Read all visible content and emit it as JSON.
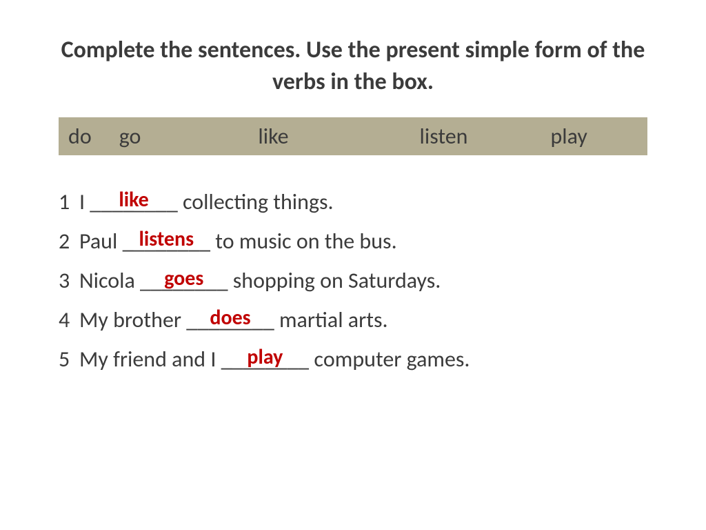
{
  "title": "Complete the sentences. Use the present simple form of  the verbs in the box.",
  "wordbox": {
    "w1": "do",
    "w2": "go",
    "w3": "like",
    "w4": "listen",
    "w5": "play"
  },
  "sentences": {
    "s1": {
      "num": "1",
      "before": "I ",
      "blank": "________",
      "answer": "like",
      "after": " collecting things."
    },
    "s2": {
      "num": "2",
      "before": "Paul ",
      "blank": "________",
      "answer": "listens",
      "after": " to music on the bus."
    },
    "s3": {
      "num": "3",
      "before": "Nicola ",
      "blank": "________",
      "answer": "goes",
      "after": " shopping on Saturdays."
    },
    "s4": {
      "num": "4",
      "before": "My brother ",
      "blank": "________",
      "answer": "does",
      "after": " martial arts."
    },
    "s5": {
      "num": "5",
      "before": "My friend and I ",
      "blank": "________",
      "answer": "play",
      "after": " сomputer games."
    }
  }
}
